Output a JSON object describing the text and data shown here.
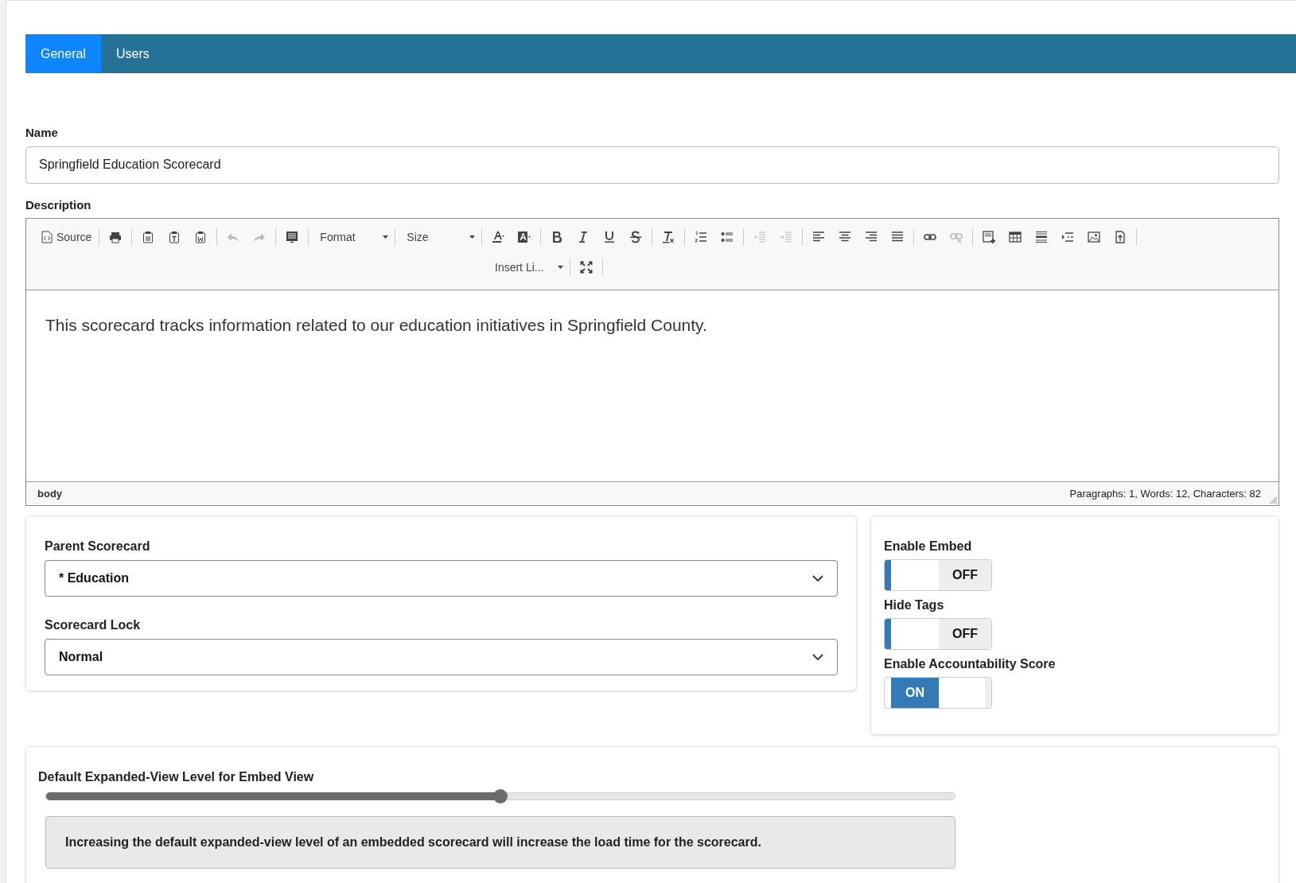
{
  "tabs": [
    {
      "label": "General",
      "selected": true
    },
    {
      "label": "Users",
      "selected": false
    }
  ],
  "name": {
    "label": "Name",
    "value": "Springfield Education Scorecard"
  },
  "description": {
    "label": "Description",
    "toolbar_rows": [
      [
        [
          {
            "kind": "text",
            "label": "Source",
            "disabled": false
          }
        ],
        [
          {
            "kind": "icon",
            "disabled": false
          }
        ],
        [
          {
            "kind": "icon",
            "disabled": false
          },
          {
            "kind": "icon",
            "disabled": false
          },
          {
            "kind": "icon",
            "disabled": false
          }
        ],
        [
          {
            "kind": "icon",
            "disabled": true
          },
          {
            "kind": "icon",
            "disabled": true
          }
        ],
        [
          {
            "kind": "icon",
            "disabled": false
          }
        ],
        [
          {
            "kind": "dropdown",
            "label": "Format",
            "disabled": false
          }
        ],
        [
          {
            "kind": "dropdown",
            "label": "Size",
            "disabled": false
          }
        ],
        [
          {
            "kind": "icon",
            "disabled": false
          },
          {
            "kind": "icon",
            "disabled": false
          }
        ],
        [
          {
            "kind": "icon",
            "disabled": false
          },
          {
            "kind": "icon",
            "disabled": false
          },
          {
            "kind": "icon",
            "disabled": false
          },
          {
            "kind": "icon",
            "disabled": false
          }
        ],
        [
          {
            "kind": "icon",
            "disabled": false
          }
        ],
        [
          {
            "kind": "icon",
            "disabled": false
          },
          {
            "kind": "icon",
            "disabled": false
          }
        ],
        [
          {
            "kind": "icon",
            "disabled": true
          },
          {
            "kind": "icon",
            "disabled": true
          }
        ],
        [
          {
            "kind": "icon",
            "disabled": false
          },
          {
            "kind": "icon",
            "disabled": false
          },
          {
            "kind": "icon",
            "disabled": false
          },
          {
            "kind": "icon",
            "disabled": false
          }
        ],
        [
          {
            "kind": "icon",
            "disabled": false
          },
          {
            "kind": "icon",
            "disabled": true
          }
        ],
        [
          {
            "kind": "icon",
            "disabled": false
          },
          {
            "kind": "icon",
            "disabled": false
          },
          {
            "kind": "icon",
            "disabled": false
          },
          {
            "kind": "icon",
            "disabled": false
          },
          {
            "kind": "icon",
            "disabled": false
          },
          {
            "kind": "icon",
            "disabled": false
          }
        ]
      ],
      [
        [
          {
            "kind": "dropdown",
            "label": "Insert Li...",
            "disabled": false
          }
        ],
        [
          {
            "kind": "icon",
            "disabled": false
          }
        ]
      ]
    ],
    "content": "This scorecard tracks information related to our education initiatives in Springfield County.",
    "path": "body",
    "counts": "Paragraphs: 1, Words: 12, Characters: 82"
  },
  "selects": [
    {
      "label": "Parent Scorecard",
      "value": "* Education"
    },
    {
      "label": "Scorecard Lock",
      "value": "Normal"
    }
  ],
  "toggles": [
    {
      "label": "Enable Embed",
      "on": false,
      "text": "OFF"
    },
    {
      "label": "Hide Tags",
      "on": false,
      "text": "OFF"
    },
    {
      "label": "Enable Accountability Score",
      "on": true,
      "text": "ON"
    }
  ],
  "embed_level": {
    "label": "Default Expanded-View Level for Embed View",
    "level": 0.5,
    "note": "Increasing the default expanded-view level of an embedded scorecard will increase the load time for the scorecard."
  }
}
